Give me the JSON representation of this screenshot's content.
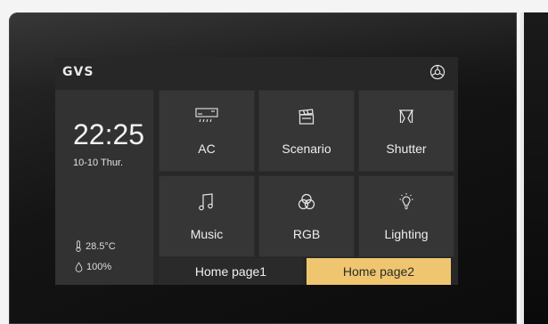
{
  "brand": {
    "logo": "GVS"
  },
  "icons": {
    "settings": "settings-gear-icon"
  },
  "status": {
    "time": "22:25",
    "date": "10-10 Thur.",
    "temperature": "28.5°C",
    "humidity": "100%"
  },
  "tiles": [
    {
      "label": "AC",
      "icon": "air-conditioner-icon"
    },
    {
      "label": "Scenario",
      "icon": "clapperboard-icon"
    },
    {
      "label": "Shutter",
      "icon": "curtain-icon"
    },
    {
      "label": "Music",
      "icon": "music-note-icon"
    },
    {
      "label": "RGB",
      "icon": "rgb-circles-icon"
    },
    {
      "label": "Lighting",
      "icon": "light-bulb-icon"
    }
  ],
  "tabs": [
    {
      "label": "Home page1",
      "active": false
    },
    {
      "label": "Home page2",
      "active": true
    }
  ],
  "colors": {
    "accent": "#efc66f",
    "screen_bg": "#272727",
    "tile_bg": "#363636",
    "text": "#eeeeee"
  }
}
